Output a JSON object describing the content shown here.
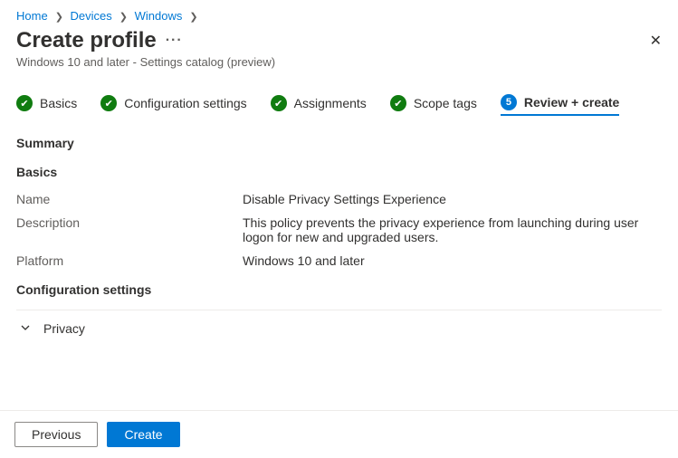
{
  "breadcrumb": {
    "items": [
      "Home",
      "Devices",
      "Windows"
    ]
  },
  "header": {
    "title": "Create profile",
    "subtitle": "Windows 10 and later - Settings catalog (preview)"
  },
  "steps": [
    {
      "label": "Basics",
      "status": "done"
    },
    {
      "label": "Configuration settings",
      "status": "done"
    },
    {
      "label": "Assignments",
      "status": "done"
    },
    {
      "label": "Scope tags",
      "status": "done"
    },
    {
      "label": "Review + create",
      "status": "active",
      "num": "5"
    }
  ],
  "summary": {
    "heading": "Summary",
    "basics_heading": "Basics",
    "name_label": "Name",
    "name_value": "Disable Privacy Settings Experience",
    "desc_label": "Description",
    "desc_value": "This policy prevents the privacy experience from launching during user logon for new and upgraded users.",
    "platform_label": "Platform",
    "platform_value": "Windows 10 and later",
    "config_heading": "Configuration settings",
    "privacy_label": "Privacy"
  },
  "footer": {
    "previous": "Previous",
    "create": "Create"
  }
}
